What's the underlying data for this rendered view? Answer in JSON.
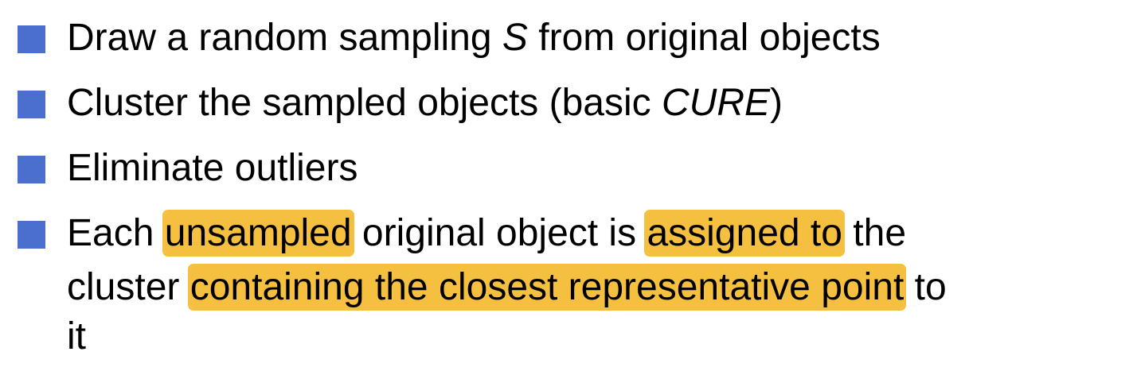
{
  "colors": {
    "bullet": "#4a6fce",
    "highlight": "#f5c040",
    "text": "#000000",
    "background": "#ffffff"
  },
  "bullets": [
    {
      "pre": "Draw a random sampling ",
      "italic": "S",
      "post": " from original objects"
    },
    {
      "pre": "Cluster the sampled objects (basic ",
      "italic": "CURE",
      "post": ")"
    },
    {
      "text": "Eliminate outliers"
    },
    {
      "line1": {
        "t1": "Each ",
        "h1": "unsampled",
        "t2": " original object is ",
        "h2": "assigned to",
        "t3": " the"
      },
      "line2": {
        "t1": "cluster ",
        "h1": "containing the closest representative point",
        "t2": " to"
      },
      "line3": {
        "t1": "it"
      }
    }
  ]
}
